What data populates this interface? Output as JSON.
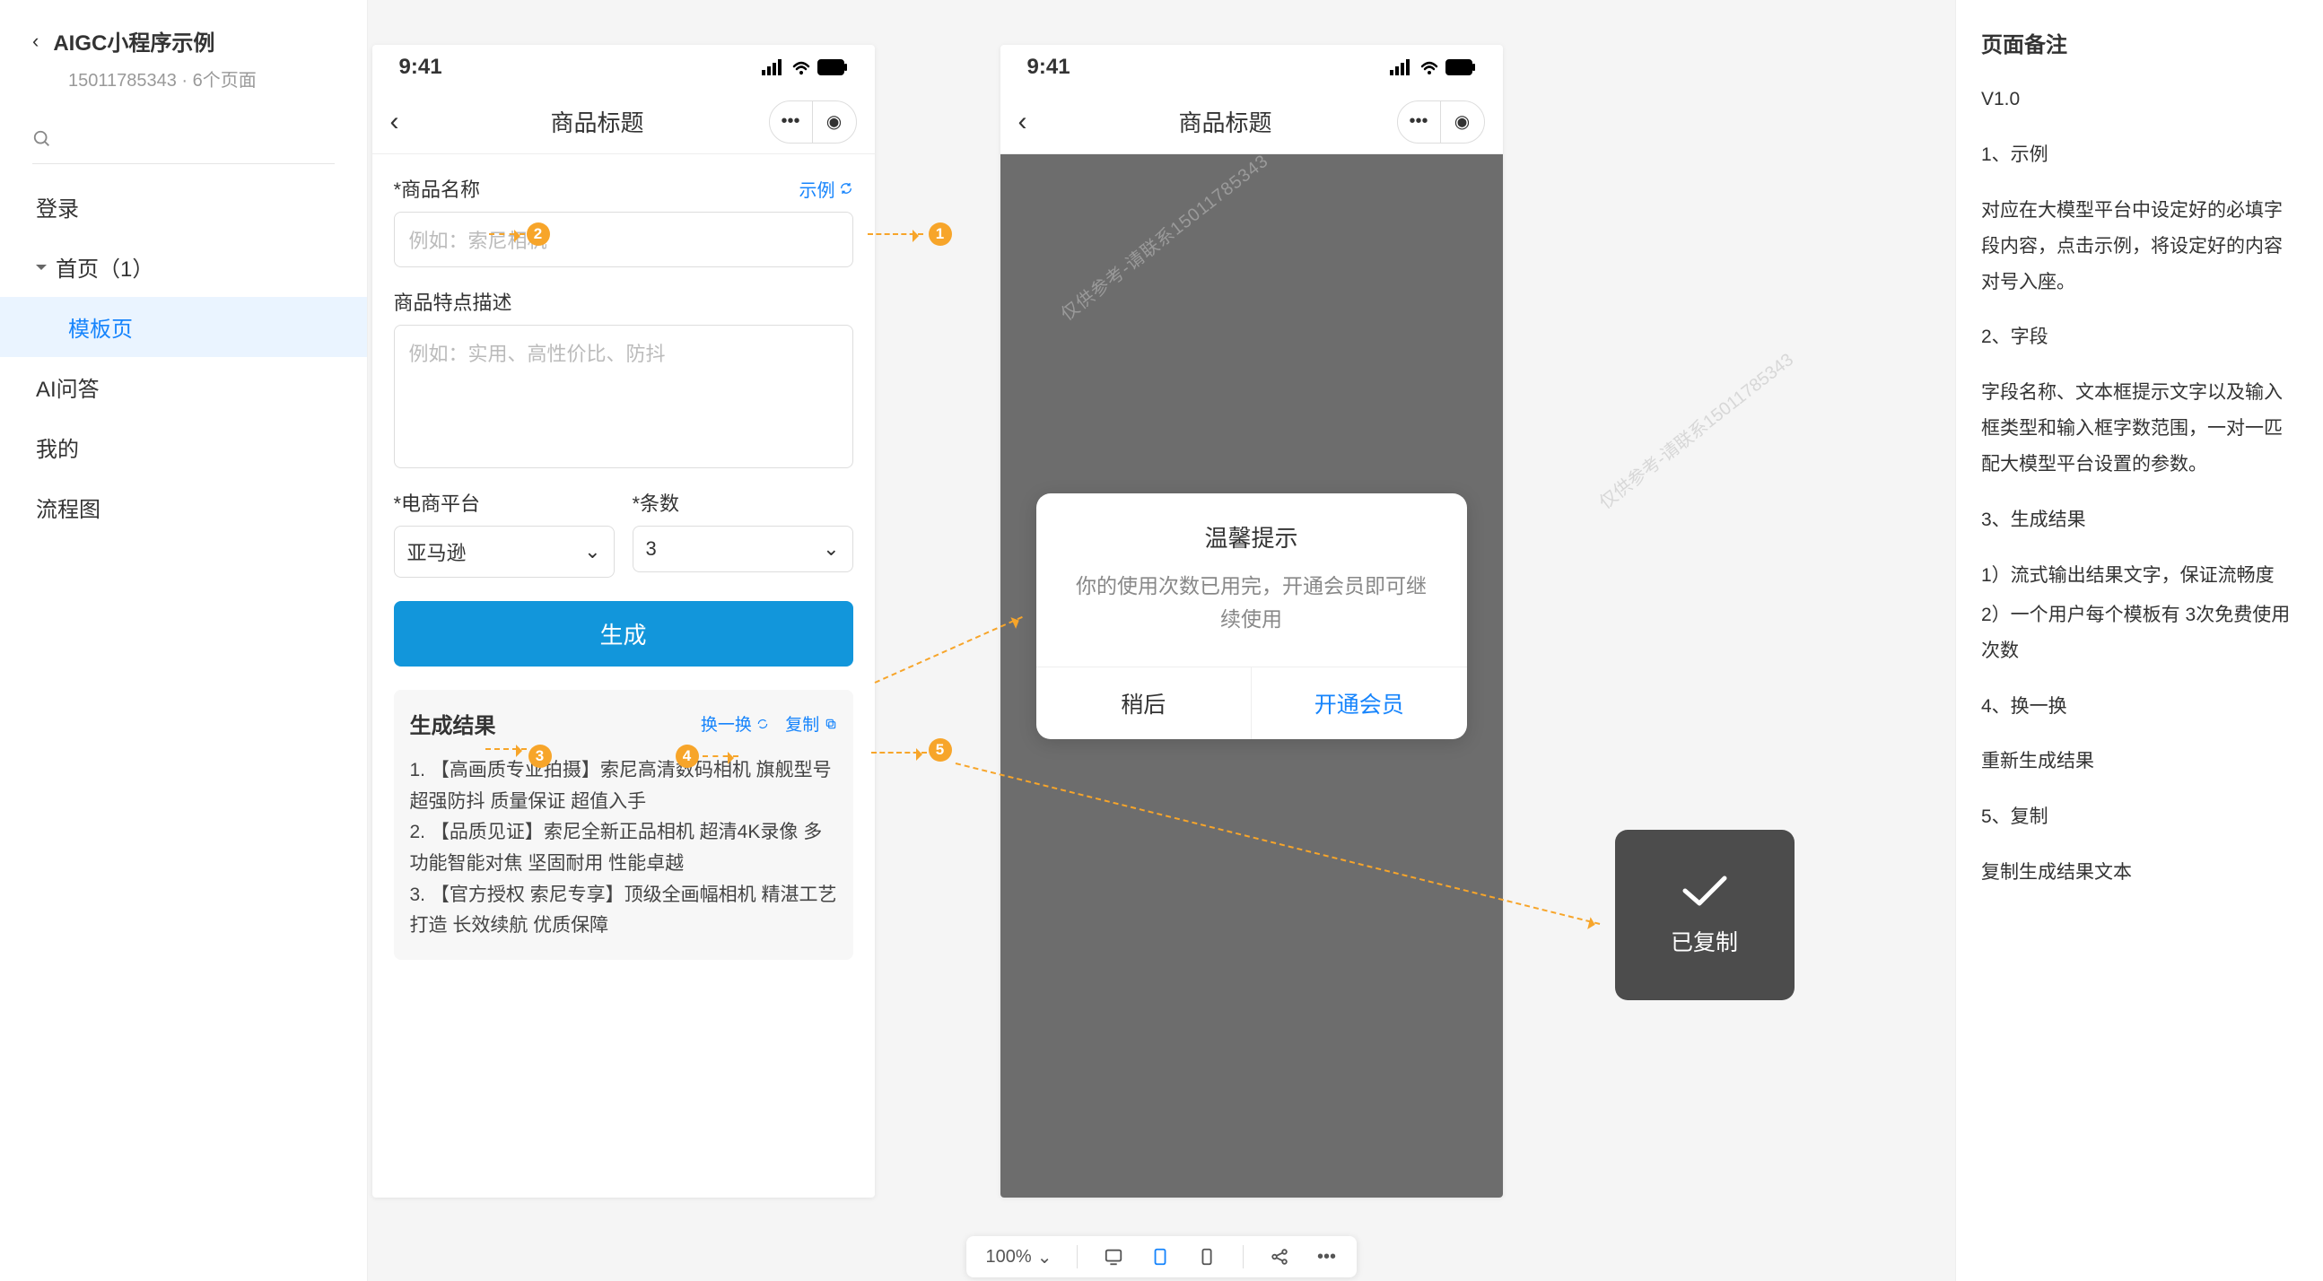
{
  "sidebar": {
    "title": "AIGC小程序示例",
    "meta_id": "15011785343",
    "meta_pages": "6个页面",
    "items": [
      {
        "label": "登录"
      },
      {
        "label": "首页（1）",
        "collapsible": true
      },
      {
        "label": "模板页",
        "child": true,
        "active": true
      },
      {
        "label": "AI问答"
      },
      {
        "label": "我的"
      },
      {
        "label": "流程图"
      }
    ]
  },
  "phone": {
    "time": "9:41",
    "nav_title": "商品标题",
    "form": {
      "name_label": "*商品名称",
      "example_link": "示例",
      "name_placeholder": "例如：索尼相机",
      "desc_label": "商品特点描述",
      "desc_placeholder": "例如：实用、高性价比、防抖",
      "platform_label": "*电商平台",
      "platform_value": "亚马逊",
      "count_label": "*条数",
      "count_value": "3",
      "generate_btn": "生成"
    },
    "result": {
      "title": "生成结果",
      "swap": "换一换",
      "copy": "复制",
      "lines": [
        "1. 【高画质专业拍摄】索尼高清数码相机 旗舰型号 超强防抖 质量保证 超值入手",
        "2. 【品质见证】索尼全新正品相机 超清4K录像 多功能智能对焦 坚固耐用 性能卓越",
        "3. 【官方授权 索尼专享】顶级全画幅相机 精湛工艺打造 长效续航 优质保障"
      ]
    }
  },
  "modal": {
    "title": "温馨提示",
    "message": "你的使用次数已用完，开通会员即可继续使用",
    "later": "稍后",
    "upgrade": "开通会员"
  },
  "toast": {
    "text": "已复制"
  },
  "watermark": "仅供参考-请联系15011785343",
  "notes": {
    "heading": "页面备注",
    "version": "V1.0",
    "blocks": [
      "1、示例",
      "对应在大模型平台中设定好的必填字段内容，点击示例，将设定好的内容对号入座。",
      "2、字段",
      "字段名称、文本框提示文字以及输入框类型和输入框字数范围，一对一匹配大模型平台设置的参数。",
      "3、生成结果",
      "1）流式输出结果文字，保证流畅度",
      "2）一个用户每个模板有 3次免费使用次数",
      "4、换一换",
      "重新生成结果",
      "5、复制",
      "复制生成结果文本"
    ]
  },
  "bottombar": {
    "zoom": "100%"
  }
}
